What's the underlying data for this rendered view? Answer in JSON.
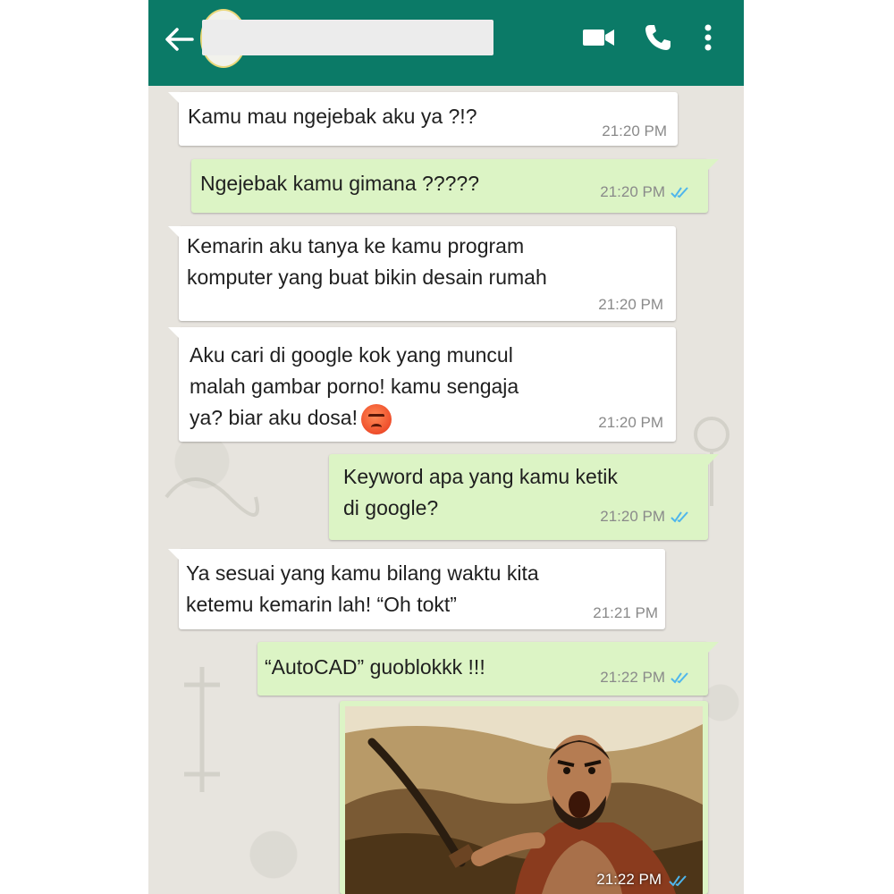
{
  "header": {
    "contact_name": "",
    "icons": [
      "back-arrow-icon",
      "avatar",
      "video-call-icon",
      "phone-call-icon",
      "more-vert-icon"
    ],
    "bar_color": "#0b7a67"
  },
  "messages": [
    {
      "dir": "in",
      "lines": [
        "Kamu mau ngejebak aku ya ?!?"
      ],
      "time": "21:20 PM"
    },
    {
      "dir": "out",
      "lines": [
        "Ngejebak kamu gimana ?????"
      ],
      "time": "21:20 PM",
      "status": "read"
    },
    {
      "dir": "in",
      "lines": [
        "Kemarin aku tanya ke kamu program",
        "komputer yang buat bikin desain rumah"
      ],
      "time": "21:20 PM"
    },
    {
      "dir": "in",
      "lines": [
        "Aku cari di google kok yang muncul",
        "malah gambar porno! kamu sengaja",
        "ya? biar aku dosa!"
      ],
      "emoji": "angry-face-emoji",
      "time": "21:20 PM"
    },
    {
      "dir": "out",
      "lines": [
        "Keyword apa yang kamu ketik",
        "di google?"
      ],
      "time": "21:20 PM",
      "status": "read"
    },
    {
      "dir": "in",
      "lines": [
        "Ya sesuai yang kamu bilang waktu kita",
        "ketemu kemarin lah! “Oh tok​t”"
      ],
      "time": "21:21 PM"
    },
    {
      "dir": "out",
      "lines": [
        "“AutoCAD” guoblokkk !!!"
      ],
      "time": "21:22 PM",
      "status": "read"
    },
    {
      "dir": "out",
      "type": "image",
      "image": "angry-warrior-shouting-photo",
      "time": "21:22 PM",
      "status": "read"
    }
  ],
  "colors": {
    "incoming_bubble": "#ffffff",
    "outgoing_bubble": "#dcf4c5",
    "read_ticks": "#4fb6ec",
    "chat_background": "#e7e4de"
  }
}
